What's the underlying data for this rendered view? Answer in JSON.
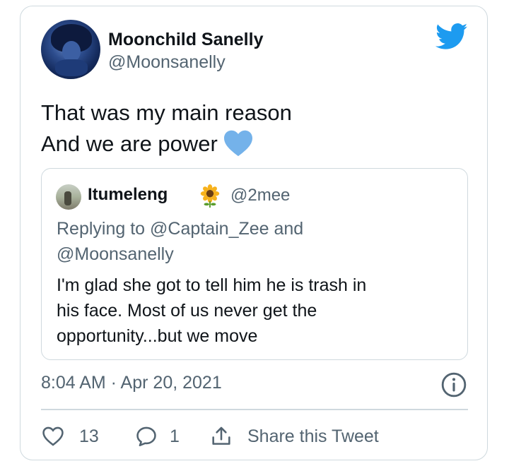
{
  "tweet": {
    "author_name": "Moonchild Sanelly",
    "author_handle": "@Moonsanelly",
    "text_line1": "That was my main reason",
    "text_line2": "And we are power",
    "emoji": "blue-heart-icon",
    "timestamp": "8:04 AM · Apr 20, 2021"
  },
  "quoted": {
    "author_name": "Itumeleng",
    "emoji": "sunflower-icon",
    "author_handle": "@2mee",
    "replying_line1": "Replying to @Captain_Zee and",
    "replying_line2": "@Moonsanelly",
    "text_line1": "I'm glad she got to tell him he is trash in",
    "text_line2": "his face. Most of us never get the",
    "text_line3": "opportunity...but we move"
  },
  "actions": {
    "like_count": "13",
    "reply_count": "1",
    "share_label": "Share this Tweet"
  },
  "colors": {
    "brand": "#1d9bf0",
    "secondary_text": "#536471",
    "border": "#cfd9de"
  }
}
